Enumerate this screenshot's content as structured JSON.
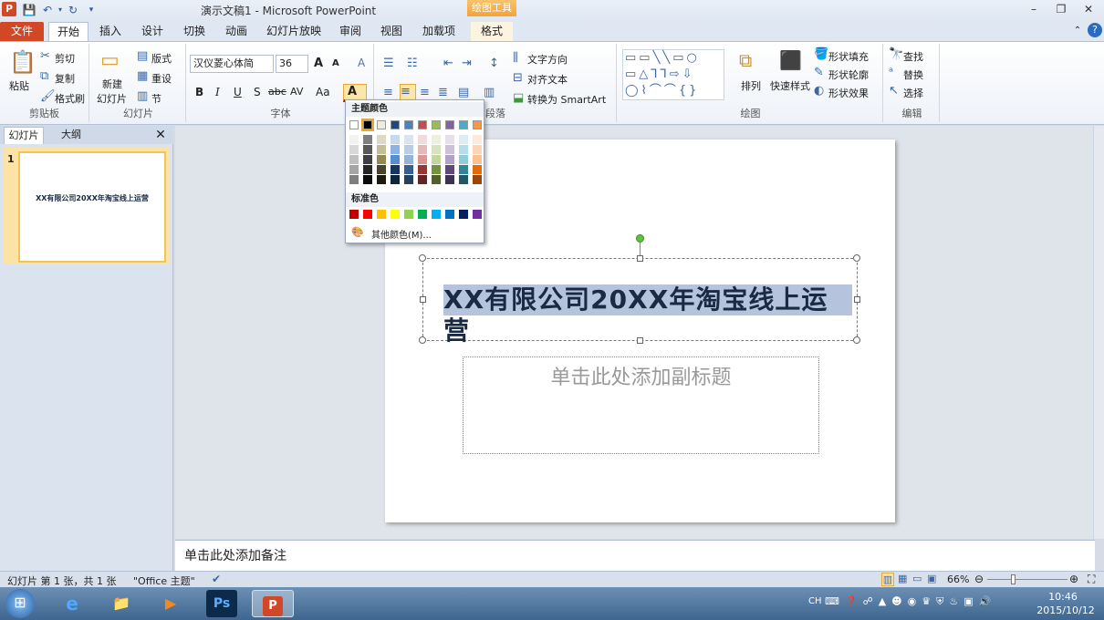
{
  "window": {
    "title": "演示文稿1 - Microsoft PowerPoint",
    "context_group": "绘图工具",
    "icon_letter": "P"
  },
  "tabs": [
    "文件",
    "开始",
    "插入",
    "设计",
    "切换",
    "动画",
    "幻灯片放映",
    "审阅",
    "视图",
    "加载项",
    "格式"
  ],
  "ribbon": {
    "clipboard": {
      "paste": "粘贴",
      "cut": "剪切",
      "copy": "复制",
      "format_painter": "格式刷",
      "label": "剪贴板"
    },
    "slides": {
      "new_slide": "新建",
      "new_slide2": "幻灯片",
      "layout": "版式",
      "reset": "重设",
      "section": "节",
      "label": "幻灯片"
    },
    "font": {
      "font_name": "汉仪菱心体简",
      "font_size": "36",
      "bold": "B",
      "italic": "I",
      "underline": "U",
      "shadow": "S",
      "strike": "abc",
      "spacing": "AV",
      "case": "Aa",
      "grow": "A",
      "shrink": "A",
      "clear": "A",
      "font_color": "A",
      "label": "字体"
    },
    "paragraph": {
      "text_direction": "文字方向",
      "align_text": "对齐文本",
      "smartart": "转换为 SmartArt",
      "label": "段落"
    },
    "drawing": {
      "arrange": "排列",
      "quick_styles": "快速样式",
      "shape_fill": "形状填充",
      "shape_outline": "形状轮廓",
      "shape_effects": "形状效果",
      "label": "绘图"
    },
    "editing": {
      "find": "查找",
      "replace": "替换",
      "select": "选择",
      "label": "编辑"
    }
  },
  "color_popup": {
    "theme_label": "主题颜色",
    "standard_label": "标准色",
    "more_colors": "其他颜色(M)...",
    "theme_top": [
      "#ffffff",
      "#000000",
      "#eeece1",
      "#1f497d",
      "#4f81bd",
      "#c0504d",
      "#9bbb59",
      "#8064a2",
      "#4bacc6",
      "#f79646"
    ],
    "theme_shades": [
      [
        "#f2f2f2",
        "#d8d8d8",
        "#bfbfbf",
        "#a5a5a5",
        "#7f7f7f"
      ],
      [
        "#7f7f7f",
        "#595959",
        "#3f3f3f",
        "#262626",
        "#0c0c0c"
      ],
      [
        "#ddd9c3",
        "#c4bd97",
        "#938953",
        "#494429",
        "#1d1b10"
      ],
      [
        "#c6d9f0",
        "#8db3e2",
        "#548dd4",
        "#17365d",
        "#0f243e"
      ],
      [
        "#dbe5f1",
        "#b8cce4",
        "#95b3d7",
        "#366092",
        "#244061"
      ],
      [
        "#f2dcdb",
        "#e5b9b7",
        "#d99694",
        "#953734",
        "#632423"
      ],
      [
        "#ebf1dd",
        "#d7e3bc",
        "#c3d69b",
        "#76923c",
        "#4f6128"
      ],
      [
        "#e5e0ec",
        "#ccc1d9",
        "#b2a2c7",
        "#5f497a",
        "#3f3151"
      ],
      [
        "#dbeef3",
        "#b7dde8",
        "#92cddc",
        "#31859b",
        "#205867"
      ],
      [
        "#fdeada",
        "#fbd5b5",
        "#fac08f",
        "#e36c09",
        "#974806"
      ]
    ],
    "standard": [
      "#c00000",
      "#ff0000",
      "#ffc000",
      "#ffff00",
      "#92d050",
      "#00b050",
      "#00b0f0",
      "#0070c0",
      "#002060",
      "#7030a0"
    ]
  },
  "left_pane": {
    "tab_slides": "幻灯片",
    "tab_outline": "大纲",
    "slide_number": "1",
    "thumb_title": "XX有限公司20XX年淘宝线上运营"
  },
  "slide": {
    "title": "XX有限公司20XX年淘宝线上运营",
    "subtitle_placeholder": "单击此处添加副标题"
  },
  "notes": {
    "placeholder": "单击此处添加备注"
  },
  "status": {
    "slide_info": "幻灯片 第 1 张，共 1 张",
    "theme": "\"Office 主题\"",
    "zoom": "66%"
  },
  "taskbar": {
    "lang": "CH",
    "time": "10:46",
    "date": "2015/10/12"
  }
}
